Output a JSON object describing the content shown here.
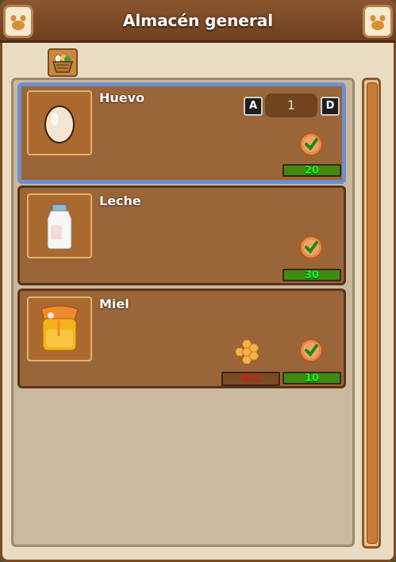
{
  "window": {
    "title": "Almacén general"
  },
  "filter": {
    "icon": "basket-icon"
  },
  "items": [
    {
      "name": "Huevo",
      "price": "20",
      "quantity": "1",
      "dec_label": "A",
      "inc_label": "D",
      "selected": true
    },
    {
      "name": "Leche",
      "price": "30"
    },
    {
      "name": "Miel",
      "price": "10",
      "requirement": "0/2"
    }
  ],
  "colors": {
    "price_text": "#14f32a",
    "requirement_text": "#d61a1a",
    "selection_border": "#6e8fd0"
  }
}
